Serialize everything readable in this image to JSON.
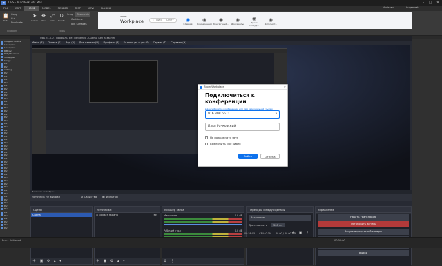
{
  "window": {
    "title": "OBS - Autodesk 3ds Max",
    "min": "–",
    "max": "□",
    "close": "✕"
  },
  "menu": [
    "FILE",
    "EDIT",
    "HOME",
    "MODEL",
    "RENDER",
    "TEST",
    "VIEW",
    "PLUGINS"
  ],
  "menu_active": 2,
  "topright": {
    "user": "Assistant",
    "workspace": "Sugarcoat"
  },
  "ribbon": {
    "clipboard": {
      "group_label": "Clipboard",
      "paste": "Paste",
      "copy": "Copy",
      "cut": "Cut",
      "duplicate": "Duplicate"
    },
    "tools": {
      "group_label": "Tools",
      "select": "Select",
      "move": "Move",
      "scale": "Scale",
      "rotate": "Rotate",
      "snap_label": "Snap",
      "snap_value": "Geometric",
      "collisions": "Collisions",
      "join": "Join Surfaces"
    }
  },
  "browser": {
    "tabs": [
      {
        "label": "Главная"
      },
      {
        "label": "Конференции"
      },
      {
        "label": "Контактный..."
      },
      {
        "label": "Документы"
      },
      {
        "label": "Доска сотруд..."
      },
      {
        "label": "Дополнит..."
      }
    ],
    "brand_top": "zoom",
    "brand_bottom": "Workplace",
    "search": "Поиск",
    "shortcut": "Ctrl+F"
  },
  "left_tree": [
    "Преднастройки",
    "Lineaycore",
    "Lineaycore",
    "RBBxlvs",
    "RMlyStructure",
    "Toolapples",
    "bridge",
    "Part",
    "Part",
    "shifting",
    "Part",
    "Part",
    "Part",
    "Part",
    "Part",
    "Part",
    "Part",
    "Part",
    "Part",
    "Part",
    "Part",
    "Part",
    "Part",
    "Part",
    "Part",
    "Part",
    "Part",
    "Part",
    "Part",
    "Part",
    "Part",
    "Part",
    "Part",
    "Part",
    "Part",
    "Part",
    "Part",
    "Part",
    "Part",
    "Part",
    "Part",
    "Part",
    "Part",
    "Part",
    "Part",
    "Part",
    "Part",
    "Part",
    "Part",
    "Part",
    "Part",
    "Part",
    "Part",
    "Part",
    "Part",
    "Part",
    "Part",
    "Part",
    "Part",
    "Part"
  ],
  "statusbar": {
    "left": "Run  ▸  Unitwand"
  },
  "obs": {
    "title": "OBS 31.0.0 - Профиль: Без названия - Сцены: Без названия",
    "menu": [
      "Файл (F)",
      "Правка (E)",
      "Вид (V)",
      "Док-панели (D)",
      "Профиль (P)",
      "Коллекция сцен (S)",
      "Сервис (T)",
      "Справка (H)"
    ],
    "info": "Источник не выбран",
    "props": "Свойства",
    "filters": "Фильтры",
    "scenes_title": "Сцены",
    "scenes": [
      "Сцена"
    ],
    "sources_title": "Источники",
    "sources": [
      "Захват экрана"
    ],
    "mixer_title": "Микшер звука",
    "mixer": [
      {
        "name": "Микрофон",
        "level": "0.0 dB"
      },
      {
        "name": "Рабочий стол",
        "level": "0.0 dB"
      }
    ],
    "transitions_title": "Переходы между сценами",
    "transition": "Затухание",
    "duration_label": "Длительность",
    "duration": "300 ms",
    "controls_title": "Управление",
    "controls": [
      "Начать трансляцию",
      "Остановить запись",
      "Запуск виртуальной камеры",
      "Режим студии",
      "Настройки",
      "Выход"
    ],
    "status": {
      "rec": "00:28:05",
      "cpu": "CPU: 0.0%",
      "fps": "60.00 / 60.00 FPS",
      "live": "00:00:00"
    }
  },
  "zoom_dialog": {
    "app": "Zoom Workplace",
    "heading": "Подключиться к конференции",
    "id_hint": "Идентификатор конференции или имя персональной ссылки",
    "meeting_id": "916 308 6671",
    "name": "Илья Рачковский",
    "opt1": "Не подключать звук",
    "opt2": "Выключить мое видео",
    "join": "Войти",
    "cancel": "Отмена",
    "accent": "#0e72ed"
  }
}
